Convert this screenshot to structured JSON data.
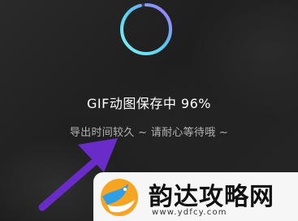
{
  "progress": {
    "percent": 96
  },
  "status": {
    "title": "GIF动图保存中 96%",
    "subtitle": "导出时间较久 ~ 请耐心等待哦 ~"
  },
  "colors": {
    "ring_start": "#7ef3f0",
    "ring_end": "#9b7cff",
    "arrow": "#6a2cc9",
    "logo_orange": "#f6a523",
    "logo_blue": "#2f9ee8"
  },
  "watermark": {
    "name": "韵达攻略网",
    "url": "www.ydfcy.com"
  }
}
